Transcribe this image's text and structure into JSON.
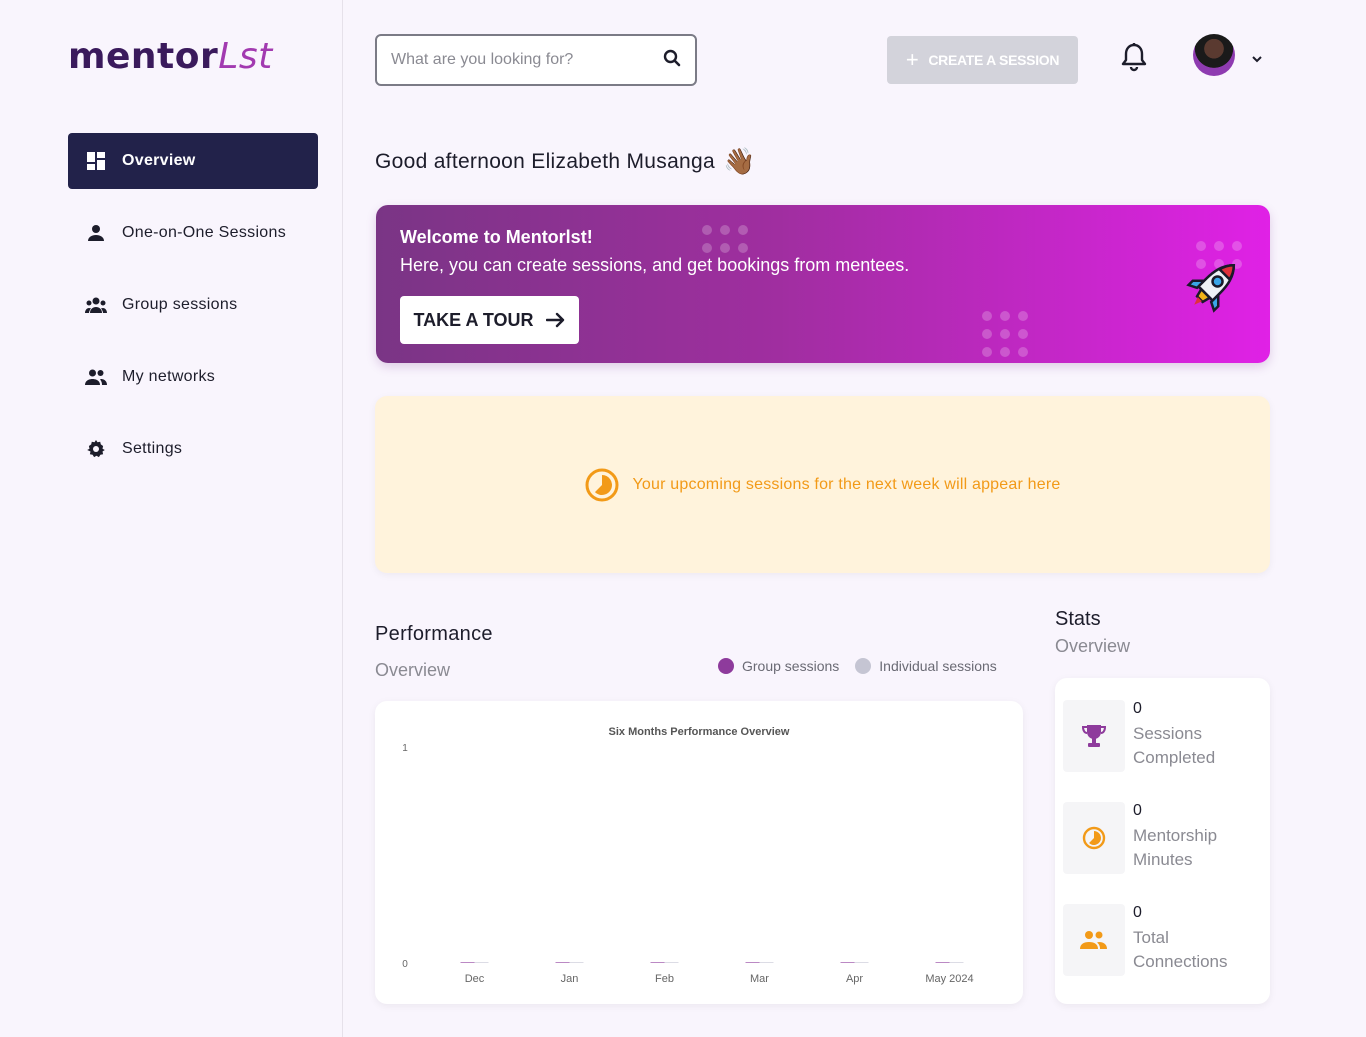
{
  "brand": {
    "logo_part1": "mentor",
    "logo_part2": "Lst"
  },
  "sidebar": {
    "items": [
      {
        "label": "Overview",
        "icon": "dashboard-icon",
        "active": true
      },
      {
        "label": "One-on-One Sessions",
        "icon": "person-icon"
      },
      {
        "label": "Group sessions",
        "icon": "groups-icon"
      },
      {
        "label": "My networks",
        "icon": "people-icon"
      },
      {
        "label": "Settings",
        "icon": "gear-icon"
      }
    ]
  },
  "header": {
    "search_placeholder": "What are you looking for?",
    "create_label": "CREATE A SESSION"
  },
  "greeting": {
    "text": "Good afternoon Elizabeth Musanga",
    "emoji": "👋🏾"
  },
  "banner": {
    "title": "Welcome to Mentorlst!",
    "subtitle": "Here, you can create sessions, and get bookings from mentees.",
    "button_label": "TAKE A TOUR"
  },
  "upcoming": {
    "message": "Your upcoming sessions for the next week will appear here"
  },
  "performance": {
    "title": "Performance",
    "subtitle": "Overview",
    "legend": [
      {
        "name": "Group sessions",
        "color": "#8e3b9c"
      },
      {
        "name": "Individual sessions",
        "color": "#c5c5d3"
      }
    ]
  },
  "chart_data": {
    "type": "bar",
    "title": "Six Months Performance Overview",
    "categories": [
      "Dec",
      "Jan",
      "Feb",
      "Mar",
      "Apr",
      "May 2024"
    ],
    "series": [
      {
        "name": "Group sessions",
        "values": [
          0,
          0,
          0,
          0,
          0,
          0
        ]
      },
      {
        "name": "Individual sessions",
        "values": [
          0,
          0,
          0,
          0,
          0,
          0
        ]
      }
    ],
    "ylim": [
      0,
      1
    ],
    "yticks": [
      "0",
      "1"
    ],
    "xlabel": "",
    "ylabel": ""
  },
  "stats": {
    "title": "Stats",
    "subtitle": "Overview",
    "items": [
      {
        "value": "0",
        "label": "Sessions Completed",
        "icon": "trophy-icon"
      },
      {
        "value": "0",
        "label": "Mentorship Minutes",
        "icon": "clock-icon"
      },
      {
        "value": "0",
        "label": "Total Connections",
        "icon": "people-icon"
      }
    ]
  },
  "colors": {
    "accent": "#22224a",
    "brand": "#8e3b9c",
    "warning": "#f29a18"
  }
}
